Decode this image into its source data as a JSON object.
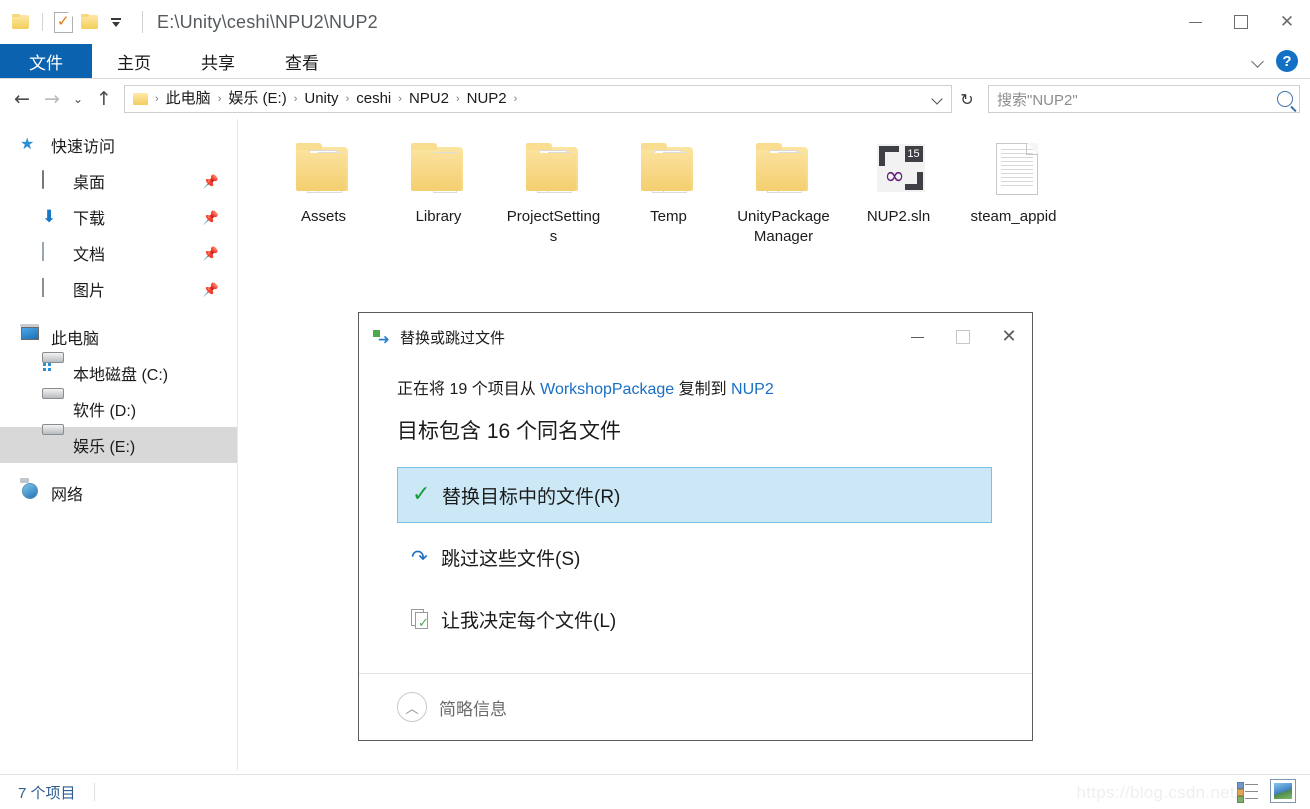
{
  "window": {
    "path_title": "E:\\Unity\\ceshi\\NPU2\\NUP2",
    "quick_access_icons": [
      "folder-icon",
      "properties-icon",
      "new-folder-icon",
      "customize-dropdown-icon"
    ],
    "controls": {
      "minimize": "—",
      "maximize": "▢",
      "close": "✕"
    }
  },
  "ribbon": {
    "tabs": [
      {
        "label": "文件",
        "active": true
      },
      {
        "label": "主页",
        "active": false
      },
      {
        "label": "共享",
        "active": false
      },
      {
        "label": "查看",
        "active": false
      }
    ],
    "expand_icon": "chevron-down-icon",
    "help_label": "?"
  },
  "addressbar": {
    "back_icon": "←",
    "forward_icon": "→",
    "history_icon": "⌄",
    "up_icon": "↑",
    "breadcrumbs": [
      "此电脑",
      "娱乐 (E:)",
      "Unity",
      "ceshi",
      "NPU2",
      "NUP2"
    ],
    "separator": "›",
    "refresh_icon": "↻",
    "dropdown_icon": "chevron-down-icon"
  },
  "search": {
    "placeholder": "搜索\"NUP2\"",
    "icon": "search-icon"
  },
  "sidebar": {
    "groups": [
      {
        "header": {
          "label": "快速访问",
          "icon": "star-icon"
        },
        "items": [
          {
            "label": "桌面",
            "icon": "desktop-icon",
            "pinned": true
          },
          {
            "label": "下载",
            "icon": "download-icon",
            "pinned": true
          },
          {
            "label": "文档",
            "icon": "documents-icon",
            "pinned": true
          },
          {
            "label": "图片",
            "icon": "pictures-icon",
            "pinned": true
          }
        ]
      },
      {
        "header": {
          "label": "此电脑",
          "icon": "computer-icon"
        },
        "items": [
          {
            "label": "本地磁盘 (C:)",
            "icon": "windows-drive-icon",
            "selected": false
          },
          {
            "label": "软件 (D:)",
            "icon": "drive-icon",
            "selected": false
          },
          {
            "label": "娱乐 (E:)",
            "icon": "drive-icon",
            "selected": true
          }
        ]
      },
      {
        "header": {
          "label": "网络",
          "icon": "network-icon"
        },
        "items": []
      }
    ],
    "pin_glyph": "📌"
  },
  "files": [
    {
      "name": "Assets",
      "type": "folder"
    },
    {
      "name": "Library",
      "type": "folder-hatched"
    },
    {
      "name": "ProjectSettings",
      "type": "folder"
    },
    {
      "name": "Temp",
      "type": "folder"
    },
    {
      "name": "UnityPackageManager",
      "type": "folder"
    },
    {
      "name": "NUP2.sln",
      "type": "visual-studio-solution",
      "badge": "15"
    },
    {
      "name": "steam_appid",
      "type": "text-file"
    }
  ],
  "statusbar": {
    "item_count": "7 个项目",
    "view_buttons": [
      "details-view-icon",
      "large-icons-view-icon"
    ],
    "watermark": "https://blog.csdn.net/"
  },
  "dialog": {
    "title": "替换或跳过文件",
    "title_icon": "copy-file-icon",
    "controls": {
      "minimize": "—",
      "maximize": "▢",
      "close": "✕"
    },
    "subtitle": {
      "prefix": "正在将 19 个项目从 ",
      "source": "WorkshopPackage",
      "middle": " 复制到 ",
      "target": "NUP2"
    },
    "heading": "目标包含 16 个同名文件",
    "options": [
      {
        "label": "替换目标中的文件(R)",
        "icon": "green-check-icon",
        "selected": true
      },
      {
        "label": "跳过这些文件(S)",
        "icon": "undo-arrow-icon",
        "selected": false
      },
      {
        "label": "让我决定每个文件(L)",
        "icon": "copy-decide-icon",
        "selected": false
      }
    ],
    "footer": {
      "label": "简略信息",
      "icon": "chevron-up-circle-icon"
    }
  },
  "colors": {
    "ribbon_active": "#0b63b0",
    "link": "#1a6fc4",
    "selection_bg": "#cce8f7",
    "selection_border": "#7cc0e4",
    "check_green": "#179c3e",
    "status_text": "#2f5d8c"
  }
}
